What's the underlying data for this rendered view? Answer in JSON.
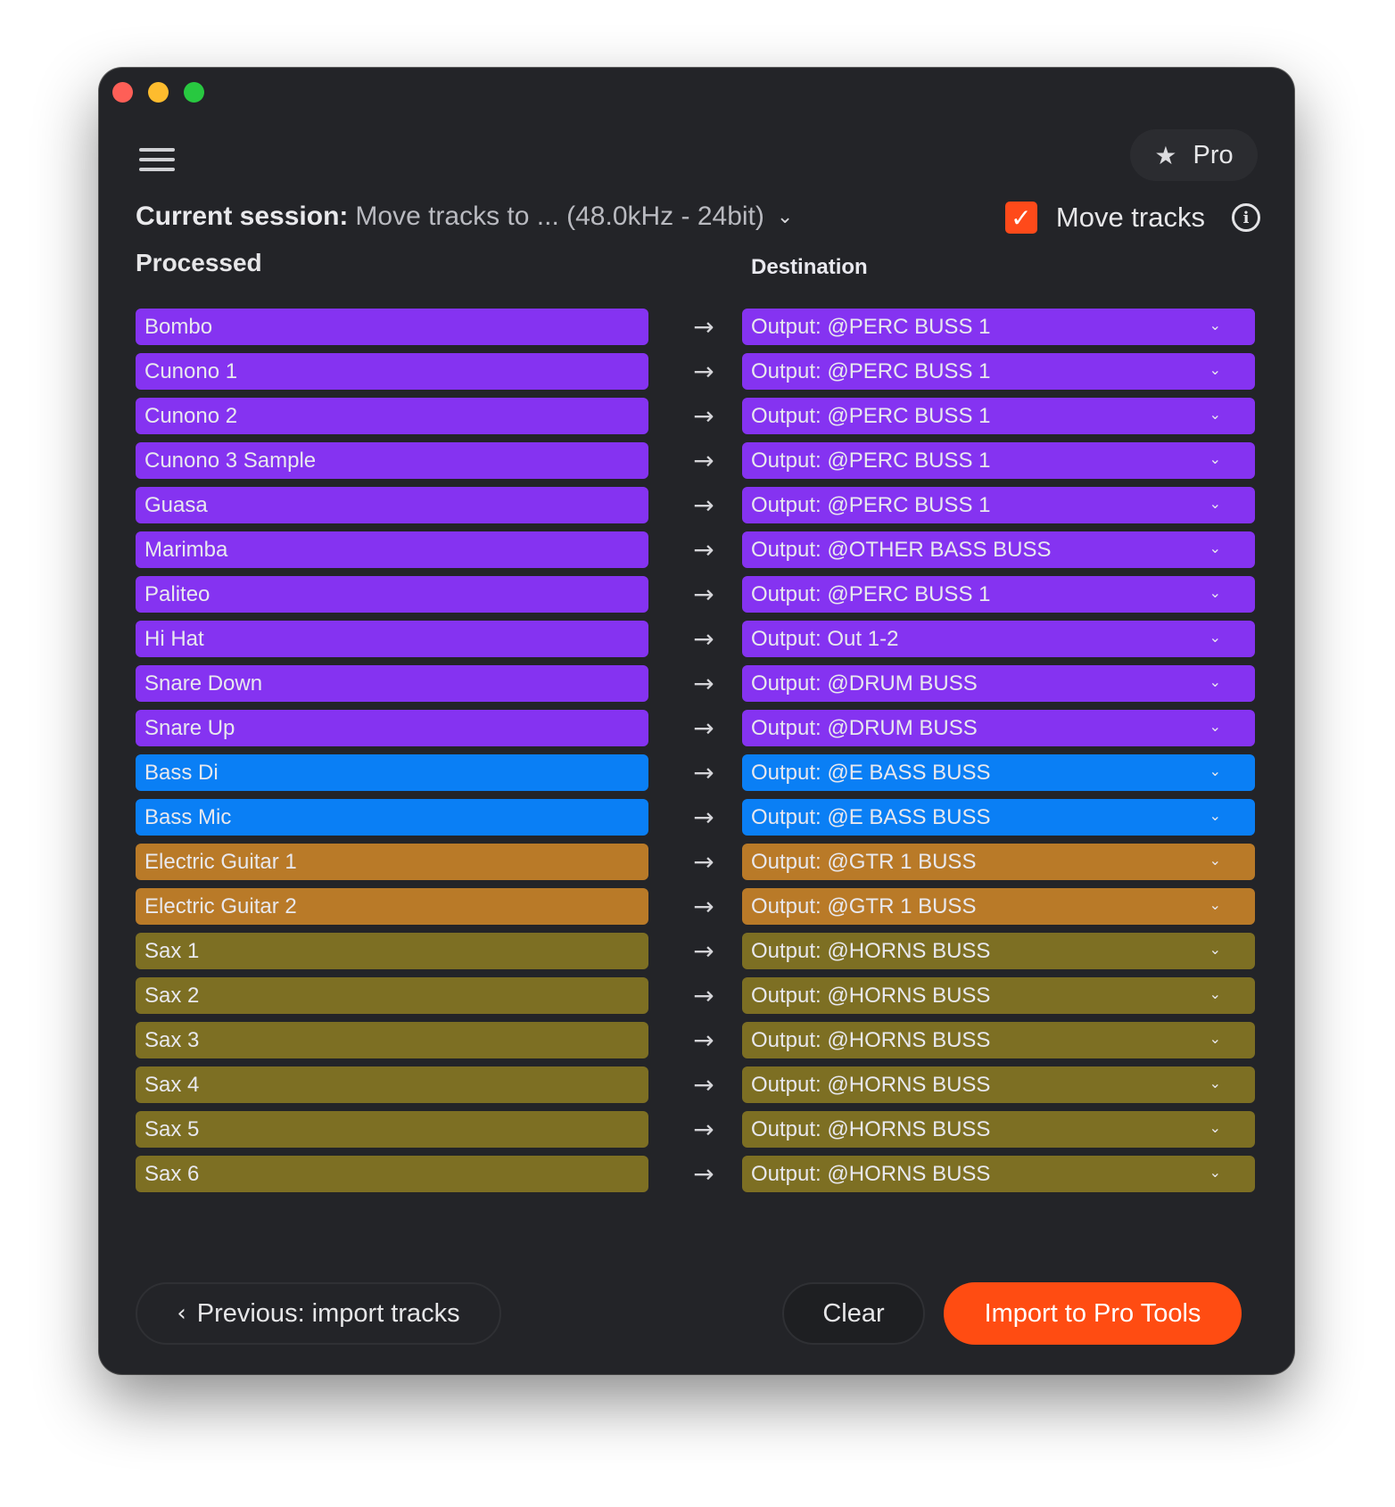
{
  "header": {
    "pro_label": "Pro",
    "session_label": "Current session:",
    "session_value": "Move tracks to ... (48.0kHz - 24bit)",
    "move_tracks_label": "Move tracks",
    "move_tracks_checked": true
  },
  "columns": {
    "processed": "Processed",
    "destination": "Destination"
  },
  "colors": {
    "purple": "#8533f1",
    "blue": "#0a7ff5",
    "orange": "#b97a28",
    "olive": "#7d6f23",
    "accent": "#ff4c12"
  },
  "rows": [
    {
      "track": "Bombo",
      "destination": "Output: @PERC BUSS 1",
      "color": "#8533f1"
    },
    {
      "track": "Cunono 1",
      "destination": "Output: @PERC BUSS 1",
      "color": "#8533f1"
    },
    {
      "track": "Cunono 2",
      "destination": "Output: @PERC BUSS 1",
      "color": "#8533f1"
    },
    {
      "track": "Cunono 3 Sample",
      "destination": "Output: @PERC BUSS 1",
      "color": "#8533f1"
    },
    {
      "track": "Guasa",
      "destination": "Output: @PERC BUSS 1",
      "color": "#8533f1"
    },
    {
      "track": "Marimba",
      "destination": "Output: @OTHER BASS BUSS",
      "color": "#8533f1"
    },
    {
      "track": "Paliteo",
      "destination": "Output: @PERC BUSS 1",
      "color": "#8533f1"
    },
    {
      "track": "Hi Hat",
      "destination": "Output: Out 1-2",
      "color": "#8533f1"
    },
    {
      "track": "Snare Down",
      "destination": "Output: @DRUM BUSS",
      "color": "#8533f1"
    },
    {
      "track": "Snare Up",
      "destination": "Output: @DRUM BUSS",
      "color": "#8533f1"
    },
    {
      "track": "Bass Di",
      "destination": "Output: @E BASS BUSS",
      "color": "#0a7ff5"
    },
    {
      "track": "Bass Mic",
      "destination": "Output: @E BASS BUSS",
      "color": "#0a7ff5"
    },
    {
      "track": "Electric Guitar 1",
      "destination": "Output: @GTR 1 BUSS",
      "color": "#b97a28"
    },
    {
      "track": "Electric Guitar 2",
      "destination": "Output: @GTR 1 BUSS",
      "color": "#b97a28"
    },
    {
      "track": "Sax 1",
      "destination": "Output: @HORNS BUSS",
      "color": "#7d6f23"
    },
    {
      "track": "Sax 2",
      "destination": "Output: @HORNS BUSS",
      "color": "#7d6f23"
    },
    {
      "track": "Sax 3",
      "destination": "Output: @HORNS BUSS",
      "color": "#7d6f23"
    },
    {
      "track": "Sax 4",
      "destination": "Output: @HORNS BUSS",
      "color": "#7d6f23"
    },
    {
      "track": "Sax 5",
      "destination": "Output: @HORNS BUSS",
      "color": "#7d6f23"
    },
    {
      "track": "Sax 6",
      "destination": "Output: @HORNS BUSS",
      "color": "#7d6f23"
    }
  ],
  "footer": {
    "previous_label": "Previous: import tracks",
    "clear_label": "Clear",
    "import_label": "Import to Pro Tools"
  }
}
